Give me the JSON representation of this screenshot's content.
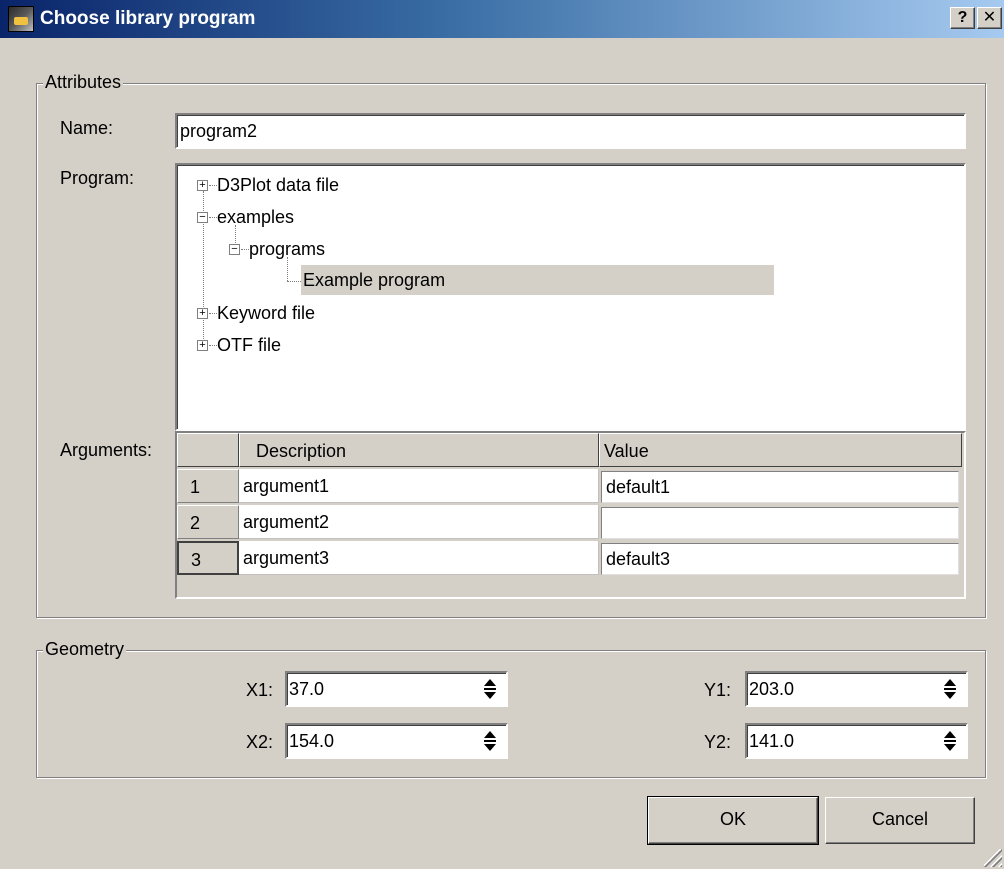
{
  "window": {
    "title": "Choose library program",
    "help_label": "?",
    "close_label": "✕"
  },
  "attributes": {
    "legend": "Attributes",
    "name_label": "Name:",
    "name_value": "program2",
    "program_label": "Program:",
    "arguments_label": "Arguments:"
  },
  "tree": [
    {
      "label": "D3Plot data file",
      "level": 0,
      "expander": "plus"
    },
    {
      "label": "examples",
      "level": 0,
      "expander": "minus"
    },
    {
      "label": "programs",
      "level": 1,
      "expander": "minus"
    },
    {
      "label": "Example program",
      "level": 2,
      "expander": "none",
      "selected": true
    },
    {
      "label": "Keyword file",
      "level": 0,
      "expander": "plus"
    },
    {
      "label": "OTF file",
      "level": 0,
      "expander": "plus"
    }
  ],
  "arguments": {
    "columns": [
      "Description",
      "Value"
    ],
    "rows": [
      {
        "num": "1",
        "description": "argument1",
        "value": "default1"
      },
      {
        "num": "2",
        "description": "argument2",
        "value": ""
      },
      {
        "num": "3",
        "description": "argument3",
        "value": "default3"
      }
    ]
  },
  "geometry": {
    "legend": "Geometry",
    "x1_label": "X1:",
    "x1_value": "37.0",
    "x2_label": "X2:",
    "x2_value": "154.0",
    "y1_label": "Y1:",
    "y1_value": "203.0",
    "y2_label": "Y2:",
    "y2_value": "141.0"
  },
  "buttons": {
    "ok_label": "OK",
    "cancel_label": "Cancel"
  },
  "icons": {
    "app": "app-icon",
    "help": "help-icon",
    "close": "close-icon",
    "expand": "plus-box-icon",
    "collapse": "minus-box-icon",
    "spin": "spin-arrows-icon",
    "resize": "resize-grip-icon"
  }
}
